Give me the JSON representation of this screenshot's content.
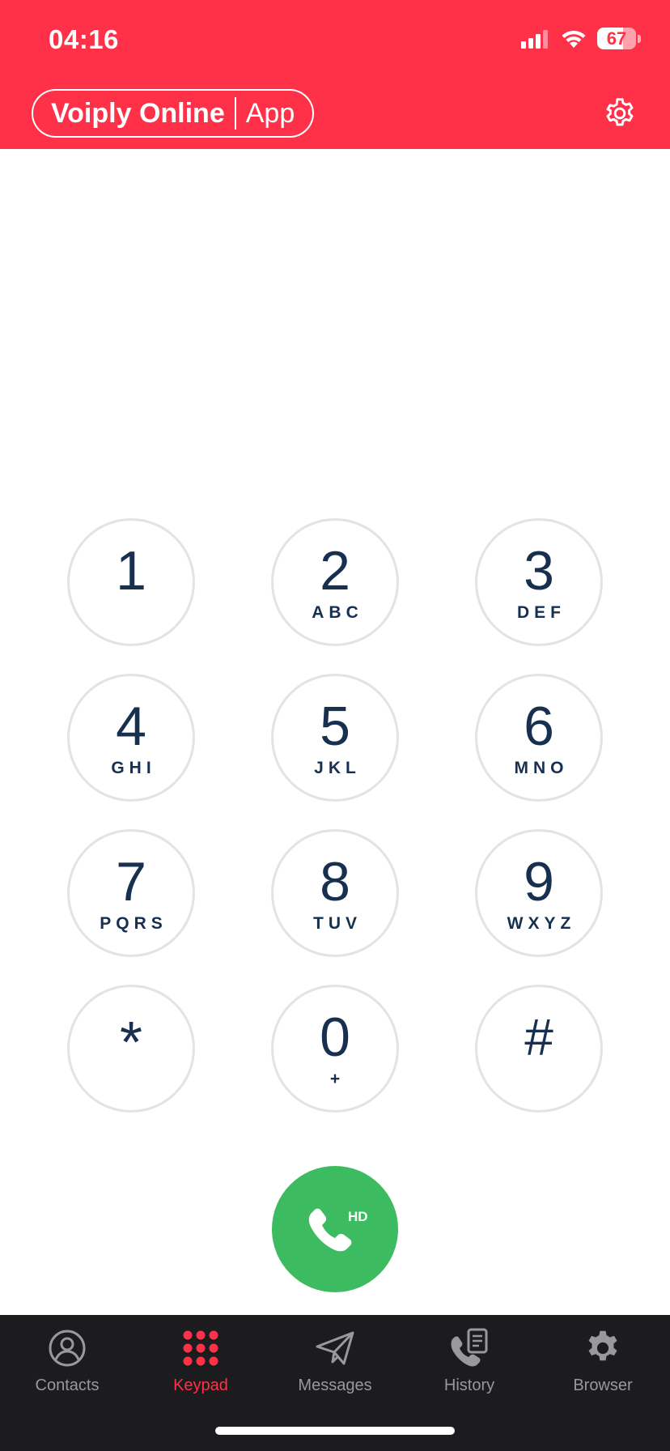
{
  "status_bar": {
    "time": "04:16",
    "battery_level": "67",
    "battery_fraction": 0.67,
    "signal_bars_active": 3,
    "signal_bars_total": 4
  },
  "header": {
    "brand_name": "Voiply Online",
    "brand_suffix": "App",
    "settings_icon": "gear-icon",
    "background_color": "#FF3148"
  },
  "keypad": {
    "keys": [
      {
        "digit": "1",
        "letters": ""
      },
      {
        "digit": "2",
        "letters": "ABC"
      },
      {
        "digit": "3",
        "letters": "DEF"
      },
      {
        "digit": "4",
        "letters": "GHI"
      },
      {
        "digit": "5",
        "letters": "JKL"
      },
      {
        "digit": "6",
        "letters": "MNO"
      },
      {
        "digit": "7",
        "letters": "PQRS"
      },
      {
        "digit": "8",
        "letters": "TUV"
      },
      {
        "digit": "9",
        "letters": "WXYZ"
      },
      {
        "digit": "*",
        "letters": ""
      },
      {
        "digit": "0",
        "letters": "+"
      },
      {
        "digit": "#",
        "letters": ""
      }
    ],
    "digit_color": "#17304F",
    "border_color": "#E1E3E8"
  },
  "call_button": {
    "badge": "HD",
    "icon": "phone-icon",
    "color": "#3DBB61"
  },
  "tabbar": {
    "tabs": [
      {
        "label": "Contacts",
        "icon": "contacts-icon",
        "active": false
      },
      {
        "label": "Keypad",
        "icon": "keypad-icon",
        "active": true
      },
      {
        "label": "Messages",
        "icon": "paper-plane-icon",
        "active": false
      },
      {
        "label": "History",
        "icon": "call-history-icon",
        "active": false
      },
      {
        "label": "Browser",
        "icon": "gear-icon",
        "active": false
      }
    ],
    "active_color": "#FF3148",
    "inactive_color": "#98989D"
  }
}
